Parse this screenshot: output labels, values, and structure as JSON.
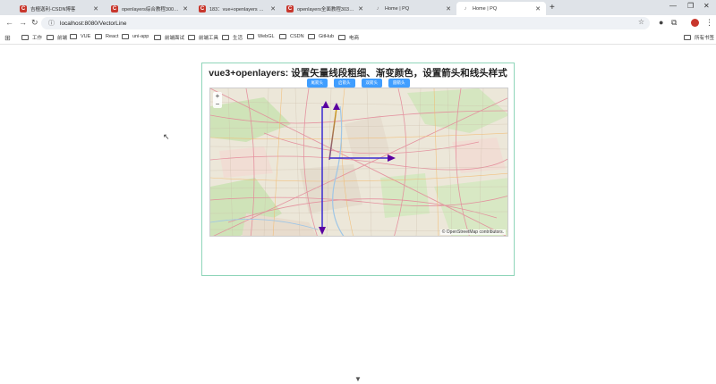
{
  "browser": {
    "tabs": [
      {
        "label": "吉檀迦利-CSDN博客",
        "favicon": "C"
      },
      {
        "label": "openlayers综合教程300+_还…",
        "favicon": "C"
      },
      {
        "label": "183：vue+openlayers 设置线…",
        "favicon": "C"
      },
      {
        "label": "openlayers全面教程303+【新…",
        "favicon": "C"
      },
      {
        "label": "Home | PQ",
        "favicon": "pq"
      },
      {
        "label": "Home | PQ",
        "favicon": "pq",
        "active": true
      }
    ],
    "url": "localhost:8080/VectorLine",
    "bookmarks": [
      "工作",
      "前端",
      "VUE",
      "React",
      "uni-app",
      "前端面试",
      "前端工具",
      "生活",
      "WebGL",
      "CSDN",
      "GitHub",
      "电商"
    ],
    "all_bookmarks": "所有书签"
  },
  "page": {
    "title": "vue3+openlayers: 设置矢量线段粗细、渐变颜色，设置箭头和线头样式",
    "buttons": [
      "尾箭头",
      "启箭头",
      "双箭头",
      "圆箭头"
    ],
    "map": {
      "zoom_in": "+",
      "zoom_out": "−",
      "attribution": "© OpenStreetMap contributors."
    }
  },
  "colors": {
    "button": "#409eff",
    "card_border": "#8fd5b9",
    "line_purple": "#5a00a0",
    "line_gold": "#d4a017",
    "line_blue": "#3a2bd0"
  }
}
